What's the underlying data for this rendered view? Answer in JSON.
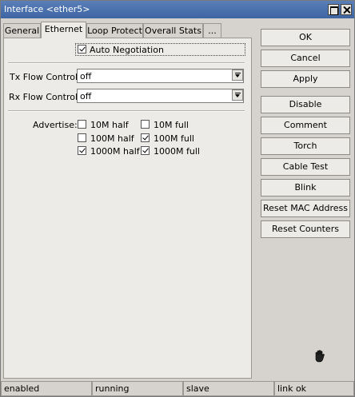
{
  "window": {
    "title": "Interface <ether5>"
  },
  "tabs": [
    {
      "label": "General"
    },
    {
      "label": "Ethernet"
    },
    {
      "label": "Loop Protect"
    },
    {
      "label": "Overall Stats"
    },
    {
      "label": "..."
    }
  ],
  "active_tab": "Ethernet",
  "ethernet": {
    "auto_negotiation": {
      "label": "Auto Negotiation",
      "checked": true
    },
    "tx_flow_control": {
      "label": "Tx Flow Control:",
      "value": "off"
    },
    "rx_flow_control": {
      "label": "Rx Flow Control:",
      "value": "off"
    },
    "advertise": {
      "label": "Advertise:",
      "options": [
        {
          "label": "10M half",
          "checked": false
        },
        {
          "label": "10M full",
          "checked": false
        },
        {
          "label": "100M half",
          "checked": false
        },
        {
          "label": "100M full",
          "checked": true
        },
        {
          "label": "1000M half",
          "checked": true
        },
        {
          "label": "1000M full",
          "checked": true
        }
      ]
    }
  },
  "buttons": [
    {
      "label": "OK"
    },
    {
      "label": "Cancel"
    },
    {
      "label": "Apply"
    },
    {
      "label": "Disable"
    },
    {
      "label": "Comment"
    },
    {
      "label": "Torch"
    },
    {
      "label": "Cable Test"
    },
    {
      "label": "Blink"
    },
    {
      "label": "Reset MAC Address"
    },
    {
      "label": "Reset Counters"
    }
  ],
  "status": [
    "enabled",
    "running",
    "slave",
    "link ok"
  ],
  "icons": {
    "cursor": "hand-cursor-icon"
  }
}
